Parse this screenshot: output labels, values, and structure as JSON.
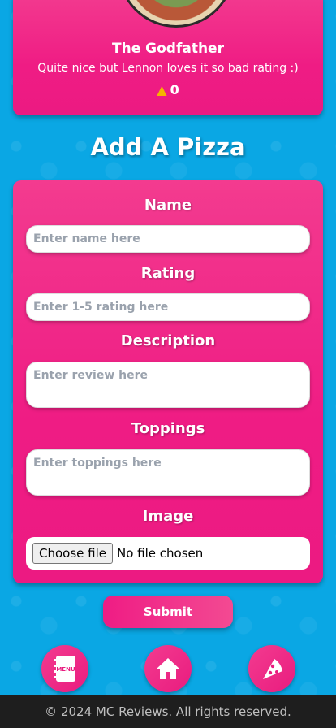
{
  "featured": {
    "title": "The Godfather",
    "review": "Quite nice but Lennon loves it so bad rating :)",
    "rating": "0"
  },
  "section_title": "Add A Pizza",
  "form": {
    "name_label": "Name",
    "name_placeholder": "Enter name here",
    "rating_label": "Rating",
    "rating_placeholder": "Enter 1-5 rating here",
    "description_label": "Description",
    "description_placeholder": "Enter review here",
    "toppings_label": "Toppings",
    "toppings_placeholder": "Enter toppings here",
    "image_label": "Image",
    "file_button": "Choose file",
    "file_status": "No file chosen",
    "submit_label": "Submit"
  },
  "nav": {
    "menu_icon": "menu-book-icon",
    "home_icon": "home-icon",
    "pizza_icon": "pizza-slice-icon"
  },
  "footer": {
    "text": "© 2024 MC Reviews. All rights reserved."
  },
  "colors": {
    "background": "#0aa7e4",
    "card": "#ef1c84",
    "footer": "#1e1e1e"
  }
}
